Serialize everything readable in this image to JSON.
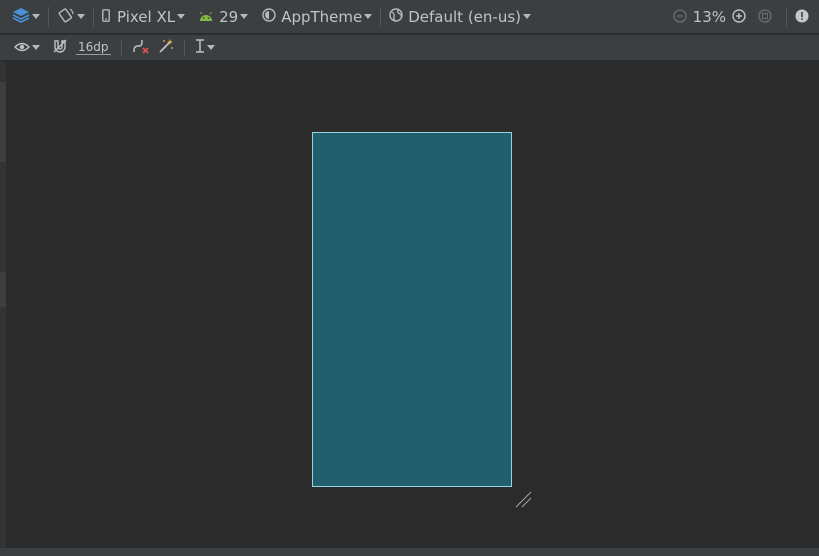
{
  "toolbar": {
    "device": "Pixel XL",
    "api_level": "29",
    "theme": "AppTheme",
    "locale": "Default (en-us)",
    "zoom": "13%"
  },
  "secondary_toolbar": {
    "margin": "16dp"
  },
  "colors": {
    "background": "#2b2b2c",
    "toolbar": "#3c3f41",
    "device_fill": "#235e6c",
    "device_border": "#8fd6e3",
    "android_green": "#7fba42",
    "layers_blue": "#4a90d9"
  },
  "icons": {
    "layers": "layers-icon",
    "orientation": "orientation-icon",
    "device": "phone-icon",
    "api": "android-icon",
    "theme": "theme-icon",
    "locale": "globe-icon",
    "zoom_out": "zoom-out-icon",
    "zoom_in": "zoom-in-icon",
    "zoom_fit": "zoom-fit-icon",
    "warning": "warning-icon",
    "visibility": "eye-icon",
    "magnet": "magnet-icon",
    "clear_constraints": "clear-constraints-icon",
    "infer_constraints": "magic-wand-icon",
    "align": "align-icon",
    "resize": "resize-handle-icon"
  }
}
